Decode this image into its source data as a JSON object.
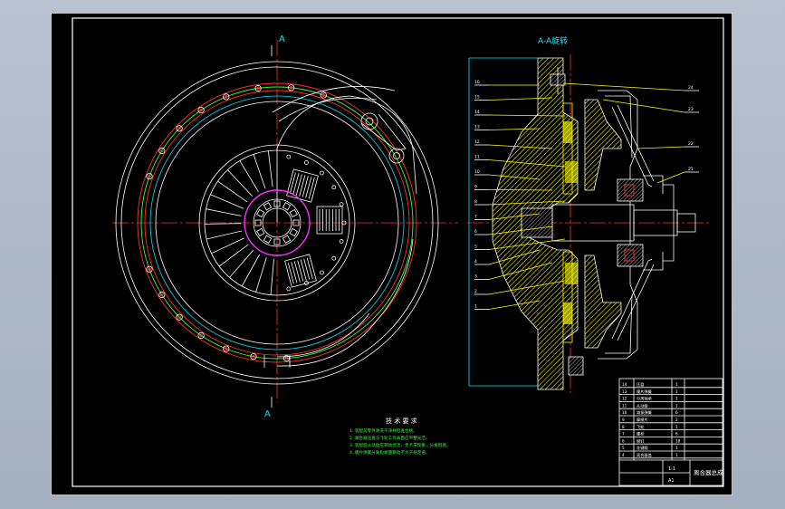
{
  "section_title": "A-A旋转",
  "section_markers": {
    "top": "A",
    "bottom": "A"
  },
  "tech_requirements": {
    "title": "技 术 要 求",
    "items": [
      "1. 装配前零件清洗干净并检查合格。",
      "2. 离合器压盘与飞轮工作表面应平整光洁。",
      "3. 装配后从动盘应转动灵活，无卡滞现象，分离彻底。",
      "4. 膜片弹簧分离指端面跳动不大于规定值。"
    ]
  },
  "part_numbers_left": [
    "16",
    "15",
    "14",
    "13",
    "12",
    "11",
    "10",
    "9",
    "8",
    "7",
    "6",
    "5",
    "4",
    "3",
    "2",
    "1"
  ],
  "part_numbers_right": [
    "24",
    "23",
    "22",
    "21"
  ],
  "title_block": {
    "drawing_name": "离合器总成",
    "scale": "1:1",
    "sheet": "A1",
    "bom_rows": [
      [
        "14",
        "压盘",
        "1"
      ],
      [
        "13",
        "膜片弹簧",
        "1"
      ],
      [
        "12",
        "分离轴承",
        "1"
      ],
      [
        "11",
        "从动盘",
        "1"
      ],
      [
        "10",
        "减振弹簧",
        "6"
      ],
      [
        "9",
        "摩擦片",
        "2"
      ],
      [
        "8",
        "飞轮",
        "1"
      ],
      [
        "7",
        "螺栓",
        "6"
      ],
      [
        "6",
        "铆钉",
        "18"
      ],
      [
        "5",
        "花键毂",
        "1"
      ],
      [
        "4",
        "离合器盖",
        "1"
      ]
    ]
  },
  "colors": {
    "background": "#000000",
    "outline": "#ffffff",
    "centerline": "#ff3030",
    "green": "#30ff30",
    "cyan": "#00e5ff",
    "magenta": "#ff30ff",
    "yellow": "#ffff00"
  }
}
